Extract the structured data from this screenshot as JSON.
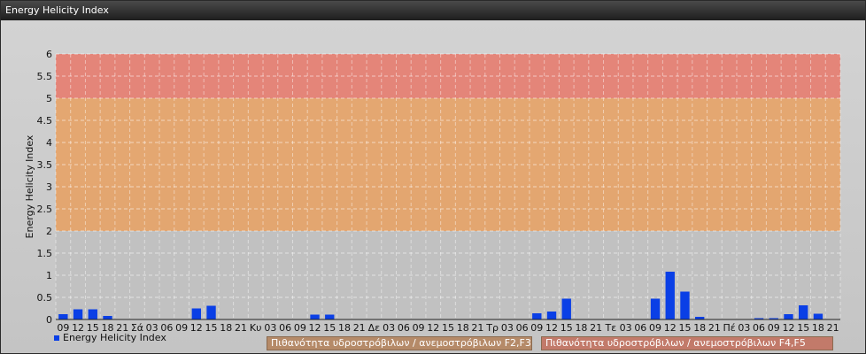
{
  "window": {
    "title": "Energy Helicity Index"
  },
  "chart_data": {
    "type": "bar",
    "title": "",
    "xlabel": "",
    "ylabel": "Energy Helicity Index",
    "ylim": [
      0,
      6
    ],
    "yticks": [
      "0",
      "0.5",
      "1",
      "1.5",
      "2",
      "2.5",
      "3",
      "3.5",
      "4",
      "4.5",
      "5",
      "5.5",
      "6"
    ],
    "grid": true,
    "legend": "bottom-left",
    "categories": [
      "09",
      "12",
      "15",
      "18",
      "21",
      "Σά",
      "03",
      "06",
      "09",
      "12",
      "15",
      "18",
      "21",
      "Κυ",
      "03",
      "06",
      "09",
      "12",
      "15",
      "18",
      "21",
      "Δε",
      "03",
      "06",
      "09",
      "12",
      "15",
      "18",
      "21",
      "Τρ",
      "03",
      "06",
      "09",
      "12",
      "15",
      "18",
      "21",
      "Τε",
      "03",
      "06",
      "09",
      "12",
      "15",
      "18",
      "21",
      "Πέ",
      "03",
      "06",
      "09",
      "12",
      "15",
      "18",
      "21"
    ],
    "series": [
      {
        "name": "Energy Helicity Index",
        "color": "#0a3fe6",
        "values": [
          0.12,
          0.23,
          0.23,
          0.08,
          0.01,
          0.01,
          0.01,
          0.01,
          0.01,
          0.25,
          0.31,
          0.01,
          0.01,
          0.01,
          0.01,
          0.01,
          0.01,
          0.11,
          0.11,
          0.01,
          0.01,
          0.01,
          0.01,
          0.01,
          0.01,
          0.01,
          0.01,
          0.01,
          0.01,
          0.01,
          0.01,
          0.01,
          0.14,
          0.18,
          0.47,
          0.01,
          0.01,
          0.01,
          0.01,
          0.01,
          0.47,
          1.08,
          0.63,
          0.06,
          0.01,
          0.01,
          0.01,
          0.03,
          0.03,
          0.12,
          0.32,
          0.13,
          0.01
        ]
      }
    ],
    "bands": [
      {
        "from": 0,
        "to": 2,
        "color": "#bfbfbf"
      },
      {
        "from": 2,
        "to": 5,
        "label": "Πιθανότητα υδροστρόβιλων / ανεμοστρόβιλων F2,F3",
        "color": "#e8a060"
      },
      {
        "from": 5,
        "to": 6,
        "label": "Πιθανότητα υδροστρόβιλων / ανεμοστρόβιλων F4,F5",
        "color": "#e8786a"
      }
    ]
  }
}
